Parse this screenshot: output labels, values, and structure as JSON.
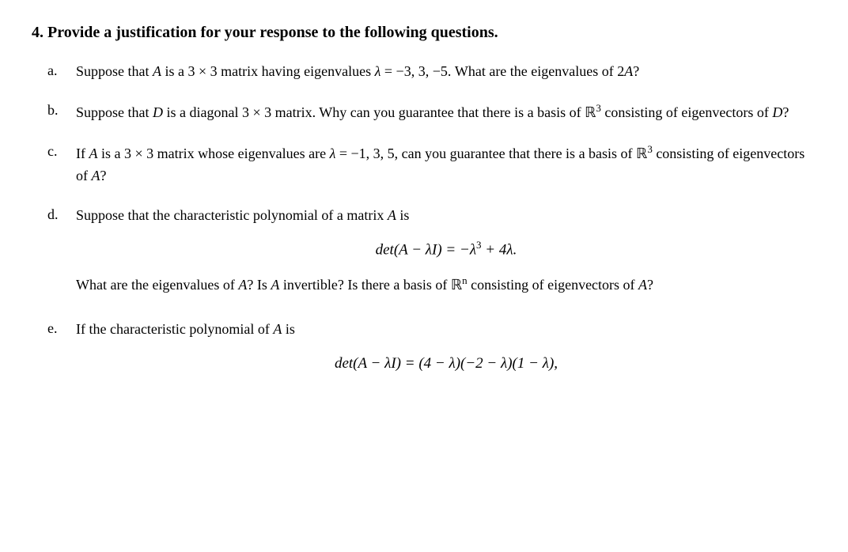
{
  "problem": {
    "number": "4.",
    "title": "Provide a justification for your response to the following questions.",
    "items": [
      {
        "label": "a.",
        "text": "Suppose that A is a 3 × 3 matrix having eigenvalues λ = −3, 3, −5. What are the eigenvalues of 2A?"
      },
      {
        "label": "b.",
        "text": "Suppose that D is a diagonal 3 × 3 matrix. Why can you guarantee that there is a basis of ℝ³ consisting of eigenvectors of D?"
      },
      {
        "label": "c.",
        "text": "If A is a 3 × 3 matrix whose eigenvalues are λ = −1, 3, 5, can you guarantee that there is a basis of ℝ³ consisting of eigenvectors of A?"
      },
      {
        "label": "d.",
        "intro": "Suppose that the characteristic polynomial of a matrix A is",
        "equation": "det(A − λI) = −λ³ + 4λ.",
        "followup": "What are the eigenvalues of A? Is A invertible? Is there a basis of ℝⁿ consisting of eigenvectors of A?"
      },
      {
        "label": "e.",
        "intro": "If the characteristic polynomial of A is",
        "equation": "det(A − λI) = (4 − λ)(−2 − λ)(1 − λ),"
      }
    ]
  }
}
